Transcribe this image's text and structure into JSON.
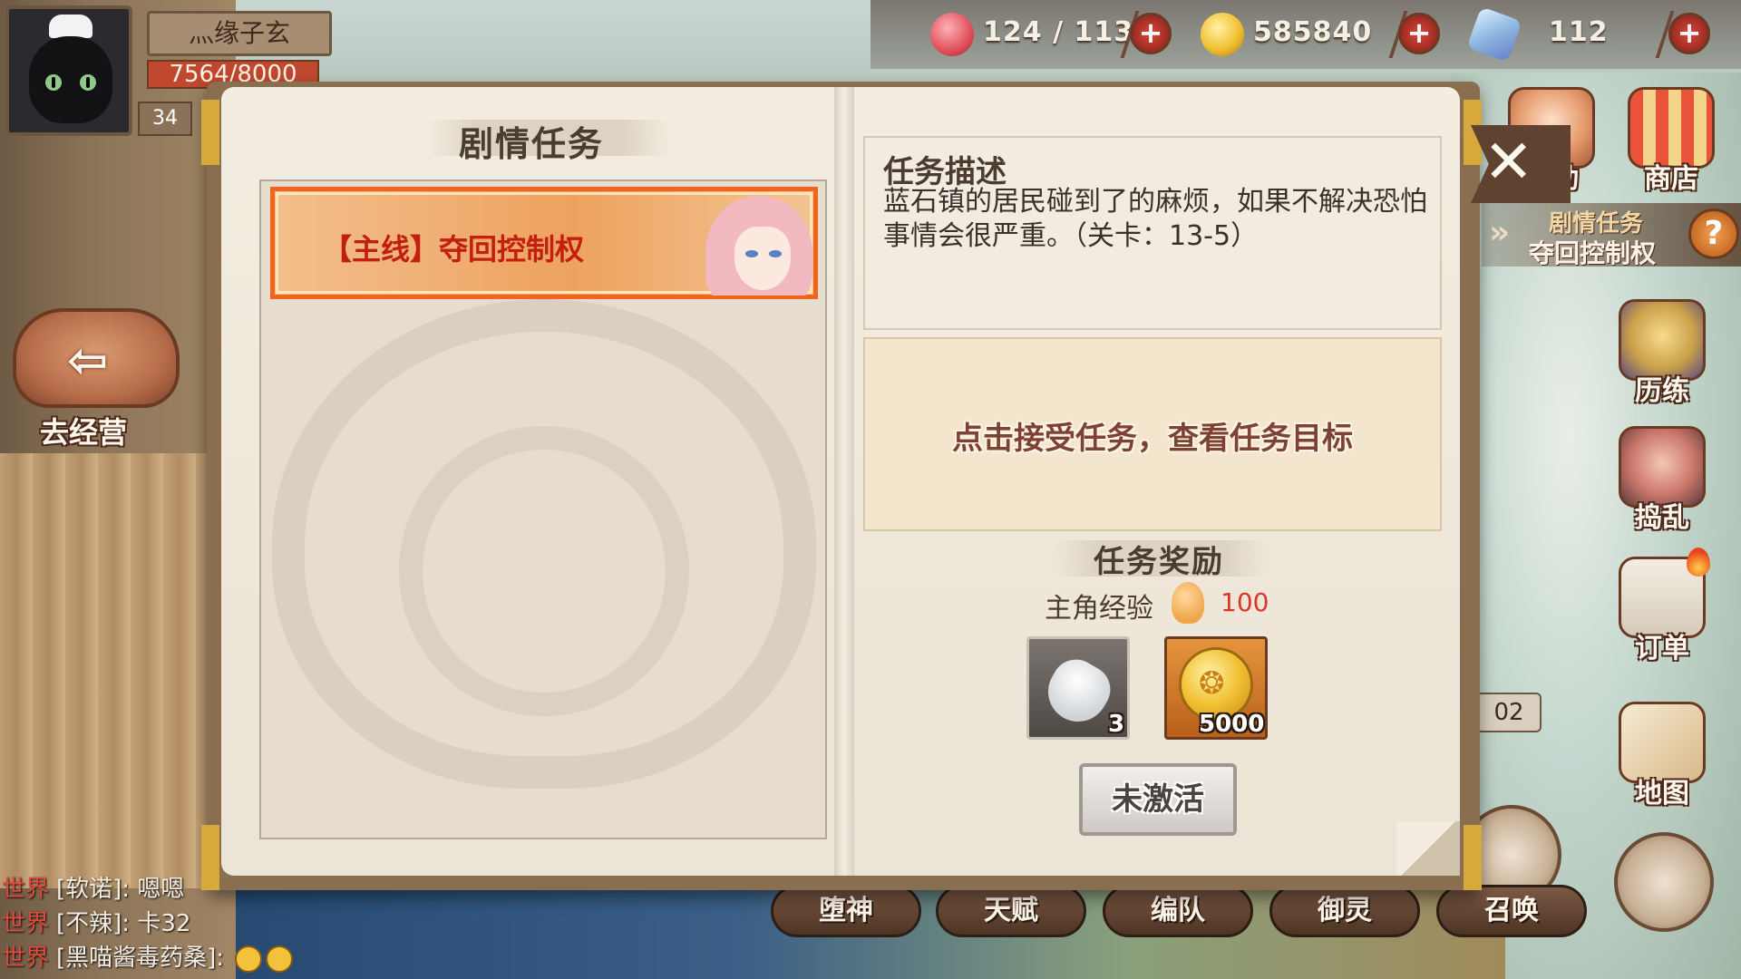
{
  "player": {
    "name": "灬缘子玄",
    "exp": "7564/8000",
    "level": "34"
  },
  "resources": [
    {
      "icon": "heart-icon",
      "value": "124 / 113",
      "color": "#e0505a"
    },
    {
      "icon": "gold-coin-icon",
      "value": "585840",
      "color": "#f1c133"
    },
    {
      "icon": "crystal-icon",
      "value": "112",
      "color": "#8db6e0"
    }
  ],
  "left_nav": {
    "go_business": "去经营"
  },
  "chat": [
    {
      "channel": "世界",
      "text": "[软诺]: 嗯嗯"
    },
    {
      "channel": "世界",
      "text": "[不辣]: 卡32"
    },
    {
      "channel": "世界",
      "text": "[黑喵酱毒药桑]:"
    }
  ],
  "right_menu": {
    "activity": "活动",
    "shop": "商店",
    "training": "历练",
    "mischief": "捣乱",
    "orders": "订单",
    "map": "地图",
    "timer": "02"
  },
  "quest_tracker": {
    "title": "剧情任务",
    "subtitle": "夺回控制权",
    "help": "?"
  },
  "bottom_nav": [
    "堕神",
    "天赋",
    "编队",
    "御灵",
    "召唤"
  ],
  "book": {
    "left_title": "剧情任务",
    "quest_item": "【主线】夺回控制权",
    "desc_title": "任务描述",
    "desc_text": "蓝石镇的居民碰到了的麻烦，如果不解决恐怕事情会很严重。（关卡：13-5）",
    "goal_hint": "点击接受任务，查看任务目标",
    "reward_title": "任务奖励",
    "exp_label": "主角经验",
    "exp_value": "100",
    "items": [
      {
        "name": "bottle",
        "count": "3"
      },
      {
        "name": "gold",
        "count": "5000"
      }
    ],
    "status_button": "未激活"
  }
}
